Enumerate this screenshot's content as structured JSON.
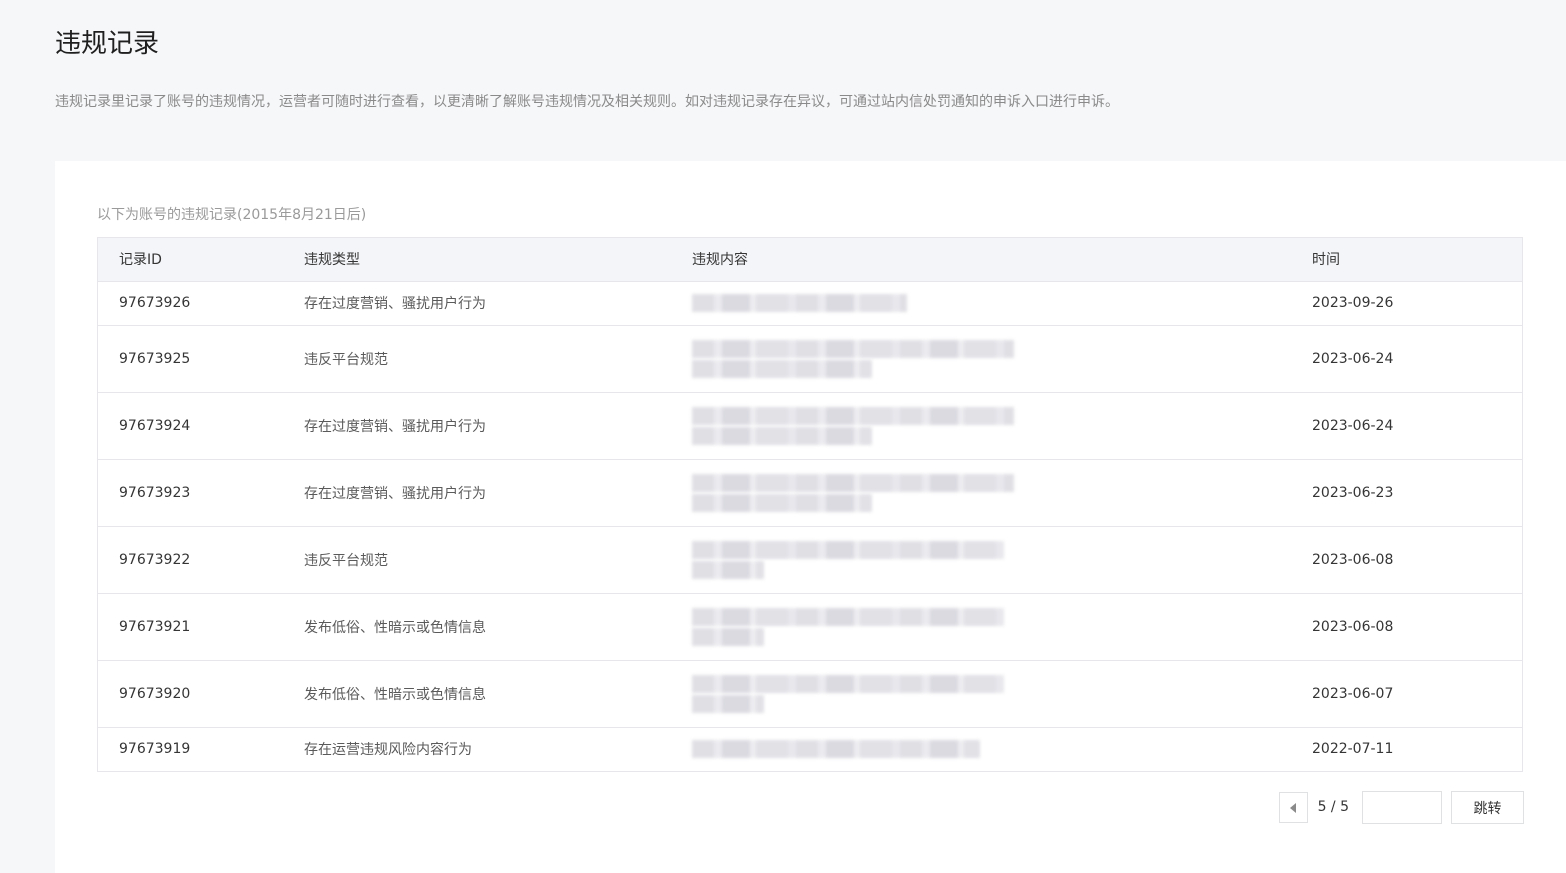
{
  "page": {
    "title": "违规记录",
    "description": "违规记录里记录了账号的违规情况，运营者可随时进行查看，以更清晰了解账号违规情况及相关规则。如对违规记录存在异议，可通过站内信处罚通知的申诉入口进行申诉。"
  },
  "table": {
    "caption": "以下为账号的违规记录(2015年8月21日后)",
    "columns": [
      "记录ID",
      "违规类型",
      "违规内容",
      "时间"
    ],
    "rows": [
      {
        "id": "97673926",
        "type": "存在过度营销、骚扰用户行为",
        "time": "2023-09-26"
      },
      {
        "id": "97673925",
        "type": "违反平台规范",
        "time": "2023-06-24"
      },
      {
        "id": "97673924",
        "type": "存在过度营销、骚扰用户行为",
        "time": "2023-06-24"
      },
      {
        "id": "97673923",
        "type": "存在过度营销、骚扰用户行为",
        "time": "2023-06-23"
      },
      {
        "id": "97673922",
        "type": "违反平台规范",
        "time": "2023-06-08"
      },
      {
        "id": "97673921",
        "type": "发布低俗、性暗示或色情信息",
        "time": "2023-06-08"
      },
      {
        "id": "97673920",
        "type": "发布低俗、性暗示或色情信息",
        "time": "2023-06-07"
      },
      {
        "id": "97673919",
        "type": "存在运营违规风险内容行为",
        "time": "2022-07-11"
      }
    ]
  },
  "pagination": {
    "prev_icon": "chevron-left-icon",
    "page_indicator": "5 / 5",
    "input_placeholder": "",
    "jump_label": "跳转"
  }
}
